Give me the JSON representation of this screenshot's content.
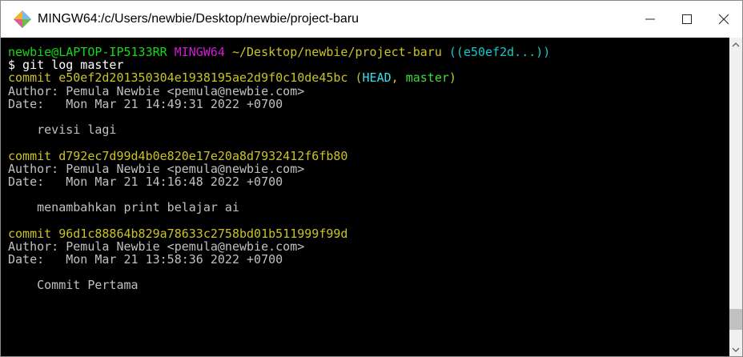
{
  "window": {
    "title": "MINGW64:/c/Users/newbie/Desktop/newbie/project-baru",
    "icon": "git-bash-icon",
    "controls": [
      "minimize-icon",
      "maximize-icon",
      "close-icon"
    ]
  },
  "colors": {
    "prompt_user": "#1ad71a",
    "prompt_env": "#d01bd0",
    "prompt_path": "#cbc225",
    "prompt_branch": "#12c9c9",
    "commit_hash": "#cbc225",
    "head_ref": "#35e0e8",
    "branch_ref": "#3fdc3f",
    "text": "#c0c0c0"
  },
  "terminal": {
    "prompt": {
      "user_host": "newbie@LAPTOP-IP5133RR",
      "env": "MINGW64",
      "path": "~/Desktop/newbie/project-baru",
      "branch": "((e50ef2d...))"
    },
    "command": "$ git log master",
    "commits": [
      {
        "commit_prefix": "commit e50ef2d201350304e1938195ae2d9f0c10de45bc",
        "ref_open": " (",
        "head": "HEAD",
        "ref_sep": ", ",
        "branch": "master",
        "ref_close": ")",
        "author": "Author: Pemula Newbie <pemula@newbie.com>",
        "date": "Date:   Mon Mar 21 14:49:31 2022 +0700",
        "message": "    revisi lagi"
      },
      {
        "commit_prefix": "commit d792ec7d99d4b0e820e17e20a8d7932412f6fb80",
        "author": "Author: Pemula Newbie <pemula@newbie.com>",
        "date": "Date:   Mon Mar 21 14:16:48 2022 +0700",
        "message": "    menambahkan print belajar ai"
      },
      {
        "commit_prefix": "commit 96d1c88864b829a78633c2758bd01b511999f99d",
        "author": "Author: Pemula Newbie <pemula@newbie.com>",
        "date": "Date:   Mon Mar 21 13:58:36 2022 +0700",
        "message": "    Commit Pertama"
      }
    ]
  },
  "scrollbar": {
    "thumb_position": 0.92,
    "thumb_size": 0.07
  }
}
